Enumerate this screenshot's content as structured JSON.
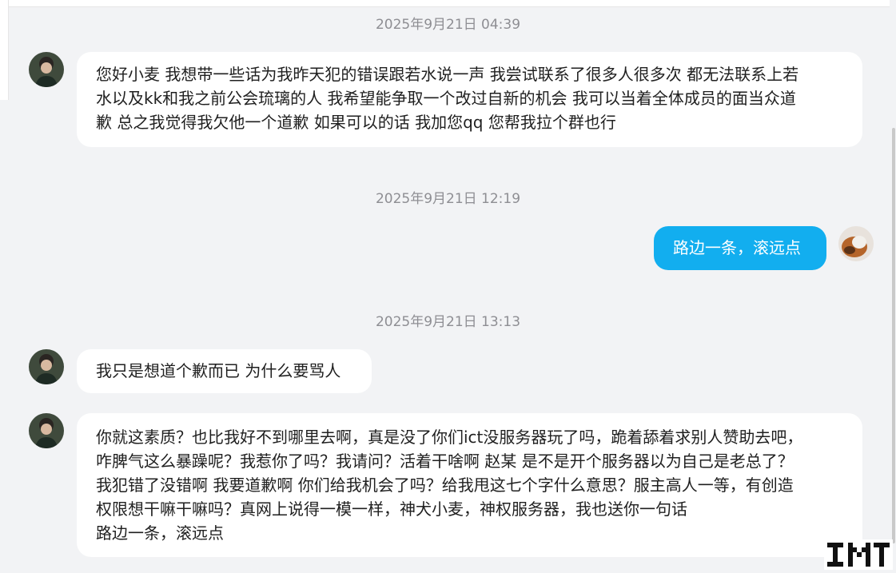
{
  "chat": {
    "messages": [
      {
        "timestamp": "2025年9月21日 04:39",
        "direction": "incoming",
        "avatar": "contact-avatar",
        "text": "您好小麦 我想带一些话为我昨天犯的错误跟若水说一声 我尝试联系了很多人很多次 都无法联系上若\n水以及kk和我之前公会琉璃的人 我希望能争取一个改过自新的机会 我可以当着全体成员的面当众道\n歉 总之我觉得我欠他一个道歉 如果可以的话 我加您qq 您帮我拉个群也行"
      },
      {
        "timestamp": "2025年9月21日 12:19",
        "direction": "outgoing",
        "avatar": "self-avatar",
        "text": "路边一条，滚远点"
      },
      {
        "timestamp": "2025年9月21日 13:13",
        "direction": "incoming",
        "avatar": "contact-avatar",
        "text": "我只是想道个歉而已 为什么要骂人"
      },
      {
        "direction": "incoming",
        "avatar": "contact-avatar",
        "text": "你就这素质？也比我好不到哪里去啊，真是没了你们ict没服务器玩了吗，跪着舔着求别人赞助去吧，\n咋脾气这么暴躁呢？我惹你了吗？我请问？活着干啥啊 赵某 是不是开个服务器以为自己是老总了？\n我犯错了没错啊 我要道歉啊 你们给我机会了吗？给我甩这七个字什么意思？服主高人一等，有创造\n权限想干嘛干嘛吗？真网上说得一模一样，神犬小麦，神权服务器，我也送你一句话\n路边一条，滚远点"
      }
    ]
  },
  "colors": {
    "background": "#f2f3f5",
    "incoming_bubble": "#ffffff",
    "outgoing_bubble": "#12aeef",
    "timestamp_text": "#8e8e93"
  },
  "watermark": {
    "icon": "pixel-logo-icon"
  }
}
